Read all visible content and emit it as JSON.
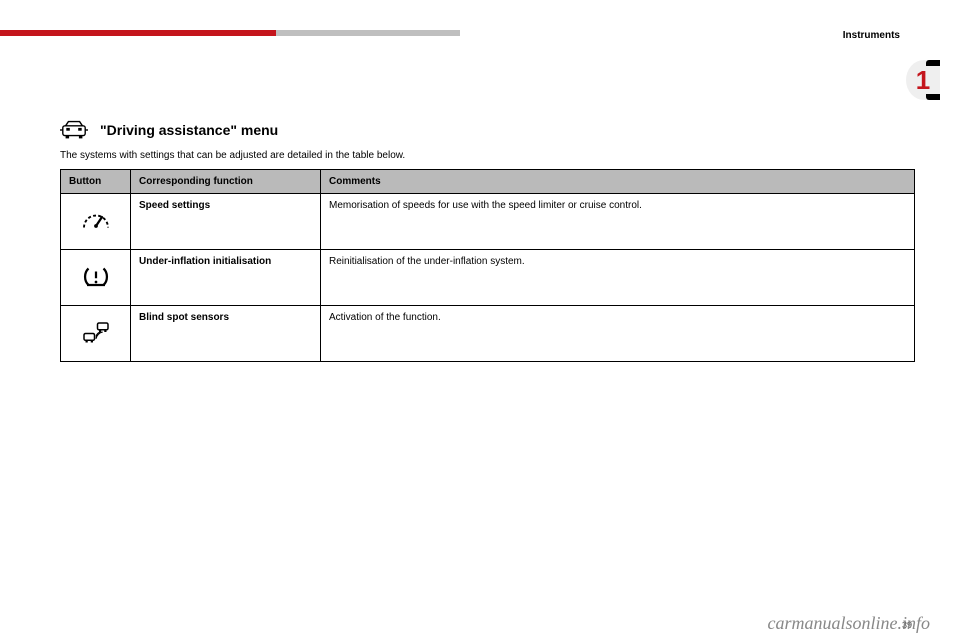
{
  "header": {
    "section_label": "Instruments",
    "chapter_number": "1"
  },
  "menu": {
    "title": "\"Driving assistance\" menu",
    "intro": "The systems with settings that can be adjusted are detailed in the table below."
  },
  "table": {
    "headers": {
      "button": "Button",
      "function": "Corresponding function",
      "comments": "Comments"
    },
    "rows": [
      {
        "icon": "speedometer-icon",
        "function": "Speed settings",
        "comments": "Memorisation of speeds for use with the speed limiter or cruise control."
      },
      {
        "icon": "tyre-pressure-icon",
        "function": "Under-inflation initialisation",
        "comments": "Reinitialisation of the under-inflation system."
      },
      {
        "icon": "blind-spot-icon",
        "function": "Blind spot sensors",
        "comments": "Activation of the function."
      }
    ]
  },
  "footer": {
    "watermark": "carmanualsonline.info",
    "page": "39"
  }
}
